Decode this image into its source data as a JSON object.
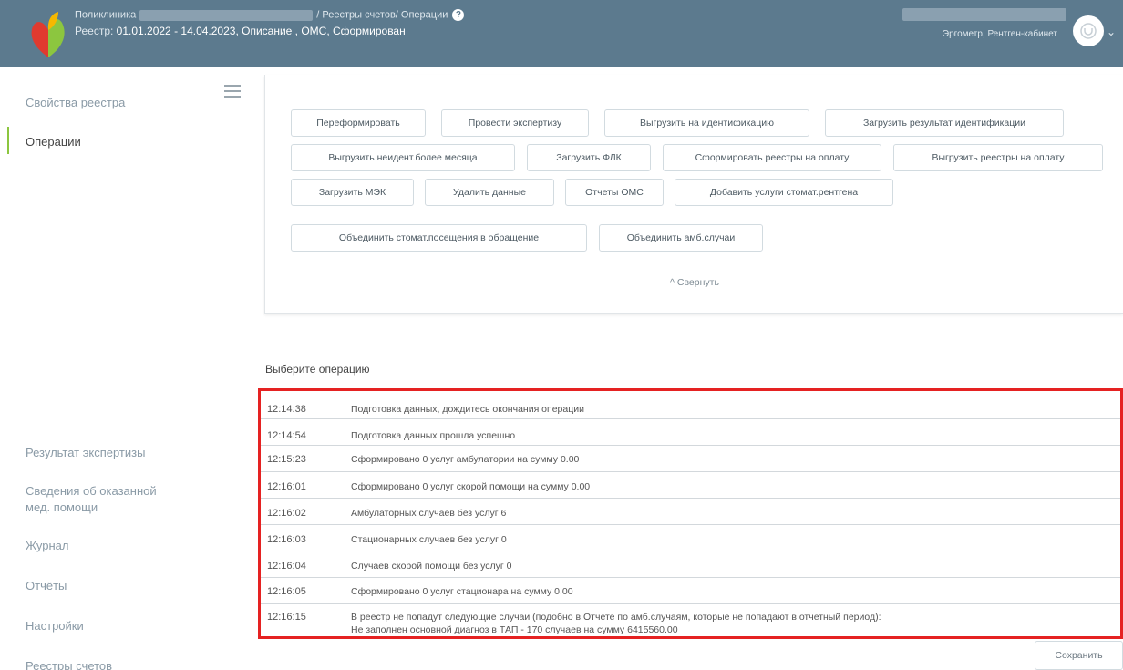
{
  "header": {
    "line1_prefix": "Поликлиника",
    "line1_suffix": "/ Реестры счетов/ Операции",
    "line2_label": "Реестр:",
    "line2_value": "01.01.2022 - 14.04.2023, Описание , ОМС, Сформирован",
    "user_role": "Эргометр, Рентген-кабинет",
    "help_icon": "question-circle-icon",
    "avatar_icon": "user-avatar-icon"
  },
  "sidebar": {
    "top_items": [
      {
        "label": "Свойства реестра"
      },
      {
        "label": "Операции"
      }
    ],
    "bottom_items": [
      {
        "label": "Результат экспертизы"
      },
      {
        "label": "Сведения об оказанной"
      },
      {
        "label": "мед. помощи"
      },
      {
        "label": "Журнал"
      },
      {
        "label": "Отчёты"
      },
      {
        "label": "Настройки"
      },
      {
        "label": "Реестры счетов"
      }
    ]
  },
  "operations": {
    "buttons": [
      "Переформировать",
      "Провести экспертизу",
      "Выгрузить на идентификацию",
      "Загрузить результат идентификации",
      "Выгрузить неидент.более месяца",
      "Загрузить ФЛК",
      "Сформировать реестры на оплату",
      "Выгрузить реестры на оплату",
      "Загрузить МЭК",
      "Удалить данные",
      "Отчеты ОМС",
      "Добавить услуги стомат.рентгена",
      "Объединить стомат.посещения в обращение",
      "Объединить амб.случаи"
    ],
    "collapse_label": "^ Свернуть"
  },
  "log": {
    "title": "Выберите операцию",
    "entries": [
      {
        "time": "12:14:38",
        "message": "Подготовка данных, дождитесь окончания операции"
      },
      {
        "time": "12:14:54",
        "message": "Подготовка данных прошла успешно"
      },
      {
        "time": "12:15:23",
        "message": "Сформировано 0 услуг амбулатории на сумму 0.00"
      },
      {
        "time": "12:16:01",
        "message": "Сформировано 0 услуг скорой помощи на сумму 0.00"
      },
      {
        "time": "12:16:02",
        "message": "Амбулаторных случаев без услуг 6"
      },
      {
        "time": "12:16:03",
        "message": "Стационарных случаев без услуг 0"
      },
      {
        "time": "12:16:04",
        "message": "Случаев скорой помощи без услуг 0"
      },
      {
        "time": "12:16:05",
        "message": "Сформировано 0 услуг стационара на сумму 0.00"
      },
      {
        "time": "12:16:15",
        "message": "В реестр не попадут следующие случаи (подобно в Отчете по амб.случаям, которые не попадают в отчетный период):",
        "message2": "Не заполнен основной диагноз в ТАП - 170 случаев на сумму 6415560.00"
      }
    ]
  },
  "save_label": "Сохранить",
  "colors": {
    "header": "#5c7a8e",
    "accent": "#8cc63f",
    "highlight_border": "#e52222"
  }
}
